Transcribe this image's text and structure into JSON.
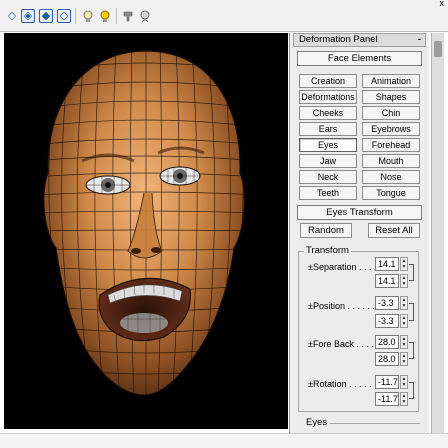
{
  "toolbar": {
    "icons": [
      {
        "name": "diamond-select-icon",
        "glyph": "◇"
      },
      {
        "name": "diamond-move-icon",
        "glyph": "◈"
      },
      {
        "name": "diamond-rotate-icon",
        "glyph": "◆"
      },
      {
        "name": "diamond-scale-icon",
        "glyph": "◇"
      },
      {
        "name": "bulb-off-icon",
        "glyph": "💡"
      },
      {
        "name": "bulb-on-icon",
        "glyph": "💡"
      },
      {
        "name": "pointer-icon",
        "glyph": "☚"
      },
      {
        "name": "head-icon",
        "glyph": "☺"
      }
    ],
    "corner": "x"
  },
  "panel": {
    "title": "Deformation Panel",
    "collapse": "-",
    "face_elements_label": "Face Elements",
    "elements": [
      [
        "Creation",
        "Animation"
      ],
      [
        "Deformations",
        "Shapes"
      ],
      [
        "Cheeks",
        "Chin"
      ],
      [
        "Ears",
        "Eyebrows"
      ],
      [
        "Eyes",
        "Forehead"
      ],
      [
        "Jaw",
        "Mouth"
      ],
      [
        "Neck",
        "Nose"
      ],
      [
        "Teeth",
        "Tongue"
      ]
    ],
    "selected": "Eyes",
    "transform_header": "Eyes Transform",
    "random_label": "Random",
    "reset_label": "Reset All",
    "transform_group_label": "Transform",
    "params": [
      {
        "label": "±Separation . . . .",
        "v1": "14.1",
        "v2": "14.1"
      },
      {
        "label": "±Position . . . . . .",
        "v1": "-3.3",
        "v2": "-3.3"
      },
      {
        "label": "±Fore Back . . . .",
        "v1": "28.0",
        "v2": "28.0"
      },
      {
        "label": "±Rotation . . . . .",
        "v1": "-11.7",
        "v2": "-11.7"
      }
    ],
    "eyes_group_label": "Eyes"
  },
  "colors": {
    "viewport_bg": "#000000",
    "skin_light": "#e0a36a",
    "skin_dark": "#6b3a17",
    "wire": "#1a0f08",
    "panel_bg": "#ececec"
  }
}
